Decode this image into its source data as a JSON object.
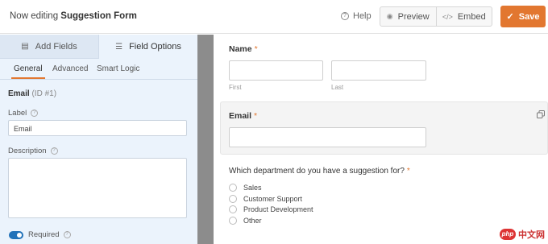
{
  "header": {
    "editing_prefix": "Now editing",
    "form_name": "Suggestion Form",
    "help_label": "Help",
    "preview_label": "Preview",
    "embed_label": "Embed",
    "save_label": "Save",
    "accent_color": "#e27730"
  },
  "sidebar": {
    "tabs": [
      {
        "label": "Add Fields",
        "icon": "list-icon"
      },
      {
        "label": "Field Options",
        "icon": "sliders-icon"
      }
    ],
    "subtabs": [
      "General",
      "Advanced",
      "Smart Logic"
    ],
    "active_subtab": "General",
    "field_name": "Email",
    "field_id": "(ID #1)",
    "label_caption": "Label",
    "label_value": "Email",
    "description_caption": "Description",
    "description_value": "",
    "required_label": "Required",
    "required_on": true
  },
  "form": {
    "name_label": "Name",
    "required_mark": "*",
    "first_sub": "First",
    "last_sub": "Last",
    "email_label": "Email",
    "department_question": "Which department do you have a suggestion for?",
    "options": [
      "Sales",
      "Customer Support",
      "Product Development",
      "Other"
    ]
  },
  "watermark": {
    "text": "中文网",
    "logo_text": "php"
  }
}
